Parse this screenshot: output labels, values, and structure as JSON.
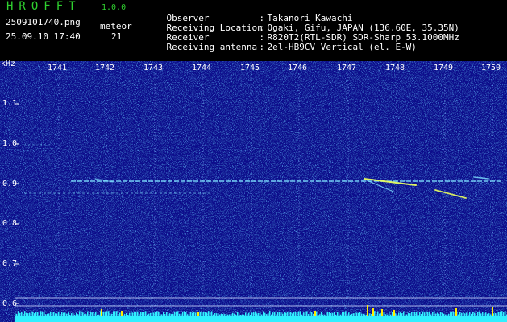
{
  "header": {
    "app_title": "HROFFT",
    "app_version": "1.0.0",
    "file_name": "2509101740.png",
    "capture_time": "25.09.10 17:40",
    "detect_type": "meteor",
    "meteor_count": "21"
  },
  "station": {
    "rows": [
      {
        "key": "Observer",
        "sep": ":",
        "value": "Takanori Kawachi"
      },
      {
        "key": "Receiving Location",
        "sep": ":",
        "value": "Ogaki, Gifu, JAPAN (136.60E, 35.35N)"
      },
      {
        "key": "Receiver",
        "sep": ":",
        "value": "R820T2(RTL-SDR) SDR-Sharp 53.1000MHz"
      },
      {
        "key": "Receiving antenna",
        "sep": ":",
        "value": "2el-HB9CV Vertical (el. E-W)"
      }
    ]
  },
  "spectrogram": {
    "freq_unit": "kHz",
    "time_ticks": [
      "1741",
      "1742",
      "1743",
      "1744",
      "1745",
      "1746",
      "1747",
      "1748",
      "1749",
      "1750"
    ],
    "freq_ticks": [
      "1.1",
      "1.0",
      "0.9",
      "0.8",
      "0.7",
      "0.6"
    ],
    "colors": {
      "background": "#0a0f8c",
      "carrier": "#7fe0ff",
      "meteor": "#e8ff60",
      "signal_strip": "#30f0ff",
      "peaks": "#ffee00",
      "text": "#ffffff",
      "accent": "#2fd02f"
    }
  }
}
